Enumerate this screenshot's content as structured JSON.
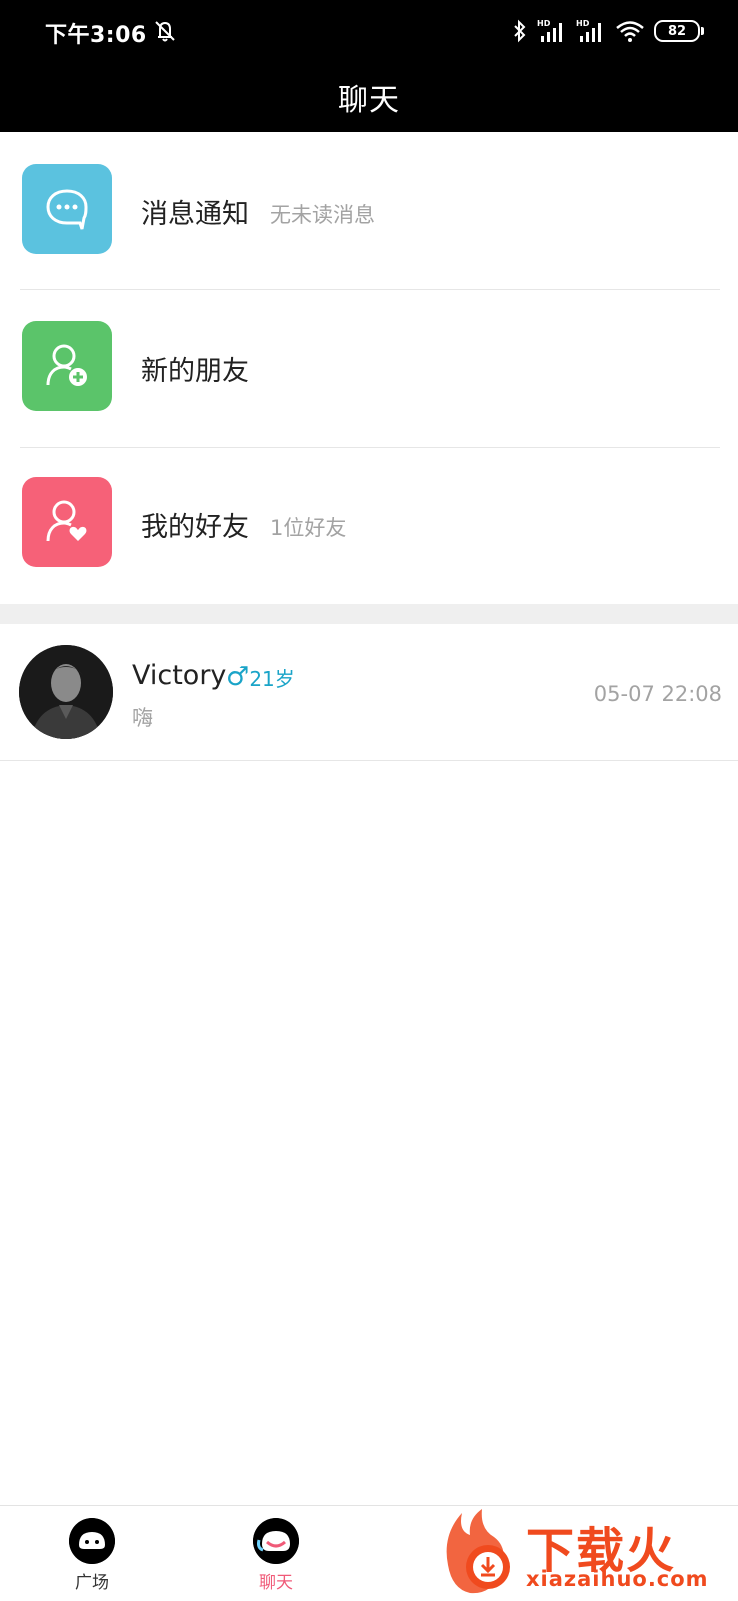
{
  "status": {
    "time": "下午3:06",
    "battery": "82"
  },
  "header": {
    "title": "聊天"
  },
  "menu": [
    {
      "label": "消息通知",
      "sub": "无未读消息",
      "icon": "chat-bubble-icon",
      "color": "#5bc2df"
    },
    {
      "label": "新的朋友",
      "sub": "",
      "icon": "add-user-icon",
      "color": "#5bc46a"
    },
    {
      "label": "我的好友",
      "sub": "1位好友",
      "icon": "user-heart-icon",
      "color": "#f66178"
    }
  ],
  "chats": [
    {
      "name": "Victory",
      "gender": "♂",
      "age": "21岁",
      "message": "嗨",
      "time": "05-07 22:08"
    }
  ],
  "tabs": [
    {
      "label": "广场",
      "icon": "square-face-icon",
      "active": false
    },
    {
      "label": "聊天",
      "icon": "chat-face-icon",
      "active": true
    }
  ],
  "watermark": {
    "text": "下载火",
    "sub": "xiazaihuo.com"
  },
  "colors": {
    "accent": "#f05a78",
    "gender": "#1aa4c8"
  }
}
